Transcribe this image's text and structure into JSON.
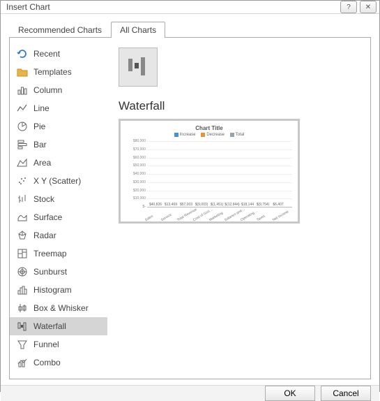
{
  "window": {
    "title": "Insert Chart",
    "help_icon": "?",
    "close_icon": "✕"
  },
  "tabs": {
    "recommended": "Recommended Charts",
    "all": "All Charts"
  },
  "sidebar": {
    "items": [
      {
        "label": "Recent"
      },
      {
        "label": "Templates"
      },
      {
        "label": "Column"
      },
      {
        "label": "Line"
      },
      {
        "label": "Pie"
      },
      {
        "label": "Bar"
      },
      {
        "label": "Area"
      },
      {
        "label": "X Y (Scatter)"
      },
      {
        "label": "Stock"
      },
      {
        "label": "Surface"
      },
      {
        "label": "Radar"
      },
      {
        "label": "Treemap"
      },
      {
        "label": "Sunburst"
      },
      {
        "label": "Histogram"
      },
      {
        "label": "Box & Whisker"
      },
      {
        "label": "Waterfall"
      },
      {
        "label": "Funnel"
      },
      {
        "label": "Combo"
      }
    ]
  },
  "main": {
    "type_title": "Waterfall"
  },
  "preview": {
    "title": "Chart Title",
    "legend": {
      "inc": "Increase",
      "dec": "Decrease",
      "tot": "Total"
    },
    "yticks": [
      "$-",
      "$10,000",
      "$20,000",
      "$30,000",
      "$40,000",
      "$50,000",
      "$60,000",
      "$70,000",
      "$80,000"
    ],
    "labels": {
      "b0": "$40,826",
      "b1": "$13,469",
      "b2": "$57,003",
      "b3": "$(9,003)",
      "b4": "$(1,451)",
      "b5": "$(12,844)",
      "b6": "$18,144",
      "b7": "$(9,754)",
      "b8": "$6,407"
    },
    "xlabels": [
      "Sales",
      "Service",
      "Total Revenue",
      "Cost of Goo…",
      "Marketing",
      "Salaries and…",
      "Operating…",
      "Taxes",
      "Net Income"
    ]
  },
  "footer": {
    "ok": "OK",
    "cancel": "Cancel"
  },
  "colors": {
    "increase": "#4a8fd0",
    "decrease": "#e8923b",
    "total": "#9aa2ad"
  },
  "chart_data": {
    "type": "bar",
    "subtype": "waterfall",
    "title": "Chart Title",
    "ylim": [
      0,
      80000
    ],
    "categories": [
      "Sales",
      "Service",
      "Total Revenue",
      "Cost of Goods",
      "Marketing",
      "Salaries and…",
      "Operating…",
      "Taxes",
      "Net Income"
    ],
    "series": [
      {
        "name": "Increase",
        "color": "#4a8fd0"
      },
      {
        "name": "Decrease",
        "color": "#e8923b"
      },
      {
        "name": "Total",
        "color": "#9aa2ad"
      }
    ],
    "values": [
      40826,
      13469,
      57003,
      -9003,
      -1451,
      -12844,
      18144,
      -9754,
      6407
    ],
    "kind": [
      "inc",
      "inc",
      "tot",
      "dec",
      "dec",
      "dec",
      "inc",
      "dec",
      "tot"
    ]
  }
}
